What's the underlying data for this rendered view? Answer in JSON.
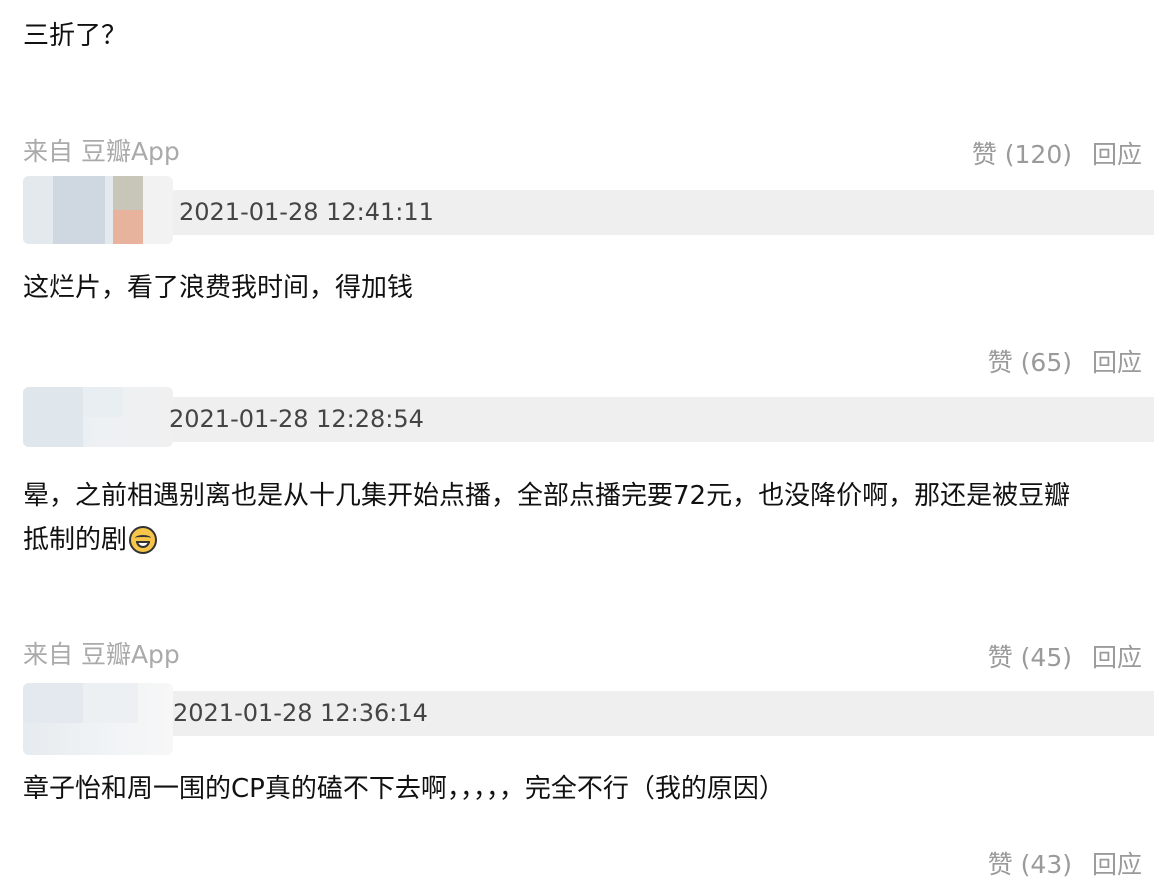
{
  "labels": {
    "source": "来自 豆瓣App",
    "reply": "回应"
  },
  "comments": [
    {
      "text": "三折了？"
    },
    {
      "likes": "赞 (120)",
      "timestamp": "2021-01-28 12:41:11",
      "text": "这烂片，看了浪费我时间，得加钱"
    },
    {
      "likes": "赞 (65)",
      "timestamp": "2021-01-28 12:28:54",
      "text_line1": "晕，之前相遇别离也是从十几集开始点播，全部点播完要72元，也没降价啊，那还是被豆瓣",
      "text_line2": "抵制的剧",
      "emoji": "laughing-with-tears-emoji"
    },
    {
      "likes": "赞 (45)",
      "timestamp": "2021-01-28 12:36:14",
      "text": "章子怡和周一围的CP真的磕不下去啊，，，，，完全不行（我的原因）"
    },
    {
      "likes": "赞 (43)"
    }
  ]
}
